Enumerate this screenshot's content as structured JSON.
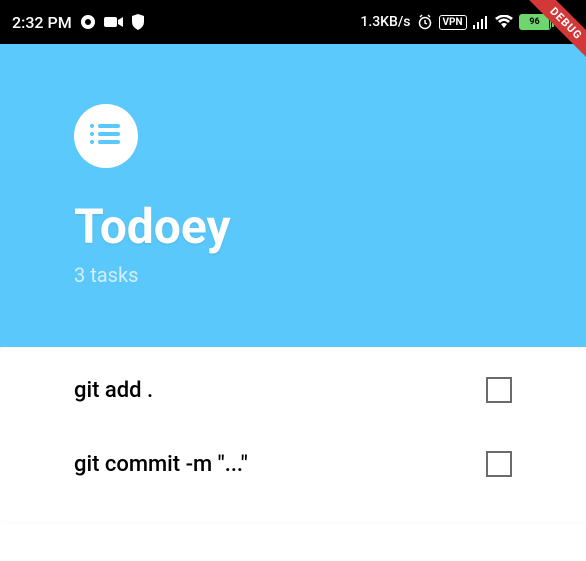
{
  "status": {
    "time": "2:32 PM",
    "speed": "1.3KB/s",
    "vpn": "VPN",
    "battery_percent": "96"
  },
  "header": {
    "title": "Todoey",
    "count": "3 tasks"
  },
  "tasks": [
    {
      "label": "git add ."
    },
    {
      "label": "git commit -m \"...\""
    }
  ],
  "debug_label": "DEBUG"
}
